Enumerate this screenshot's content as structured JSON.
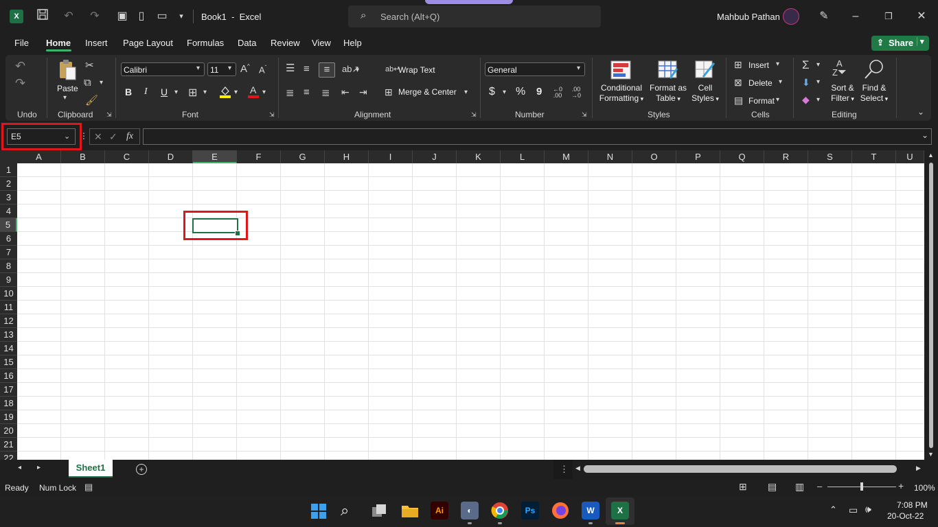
{
  "titlebar": {
    "doc_title": "Book1  -  Excel",
    "search_placeholder": "Search (Alt+Q)",
    "user_name": "Mahbub Pathan"
  },
  "menu": {
    "items": [
      "File",
      "Home",
      "Insert",
      "Page Layout",
      "Formulas",
      "Data",
      "Review",
      "View",
      "Help"
    ],
    "share_label": "Share"
  },
  "ribbon": {
    "groups": {
      "undo": "Undo",
      "clipboard": "Clipboard",
      "font": "Font",
      "alignment": "Alignment",
      "number": "Number",
      "styles": "Styles",
      "cells": "Cells",
      "editing": "Editing"
    },
    "paste": "Paste",
    "font_name": "Calibri",
    "font_size": "11",
    "bold": "B",
    "italic": "I",
    "underline": "U",
    "wrap_text": "Wrap Text",
    "merge_center": "Merge & Center",
    "number_format": "General",
    "currency": "$",
    "percent": "%",
    "comma": "9",
    "cond_fmt_1": "Conditional",
    "cond_fmt_2": "Formatting",
    "fmt_table_1": "Format as",
    "fmt_table_2": "Table",
    "cell_styles_1": "Cell",
    "cell_styles_2": "Styles",
    "insert": "Insert",
    "delete": "Delete",
    "format": "Format",
    "sort_filter_1": "Sort &",
    "sort_filter_2": "Filter",
    "find_select_1": "Find &",
    "find_select_2": "Select"
  },
  "formula_bar": {
    "name_box": "E5",
    "fx": "fx",
    "value": ""
  },
  "grid": {
    "columns": [
      "A",
      "B",
      "C",
      "D",
      "E",
      "F",
      "G",
      "H",
      "I",
      "J",
      "K",
      "L",
      "M",
      "N",
      "O",
      "P",
      "Q",
      "R",
      "S",
      "T",
      "U"
    ],
    "rows": [
      "1",
      "2",
      "3",
      "4",
      "5",
      "6",
      "7",
      "8",
      "9",
      "10",
      "11",
      "12",
      "13",
      "14",
      "15",
      "16",
      "17",
      "18",
      "19",
      "20",
      "21",
      "22"
    ],
    "selected_column": "E",
    "selected_row": "5"
  },
  "sheets": {
    "tabs": [
      "Sheet1"
    ],
    "active": "Sheet1"
  },
  "status": {
    "ready": "Ready",
    "num_lock": "Num Lock",
    "zoom": "100%"
  },
  "taskbar": {
    "time": "7:08 PM",
    "date": "20-Oct-22",
    "apps": [
      "start-icon",
      "search-icon",
      "task-view-icon",
      "file-explorer-icon",
      "illustrator-icon",
      "app-icon",
      "chrome-icon",
      "photoshop-icon",
      "firefox-icon",
      "word-icon",
      "excel-icon"
    ]
  },
  "colors": {
    "accent_green": "#1e7145",
    "highlight_red": "#e1161d",
    "share_green": "#1f7a46"
  }
}
